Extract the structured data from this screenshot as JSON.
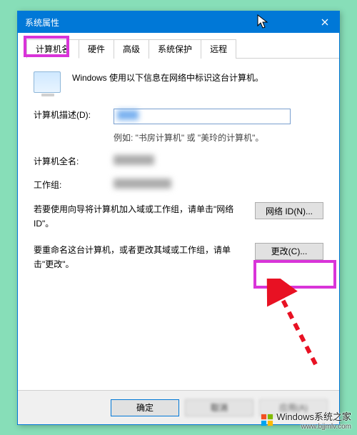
{
  "window": {
    "title": "系统属性"
  },
  "tabs": {
    "computer_name": "计算机名",
    "hardware": "硬件",
    "advanced": "高级",
    "system_protection": "系统保护",
    "remote": "远程"
  },
  "intro_text": "Windows 使用以下信息在网络中标识这台计算机。",
  "labels": {
    "description": "计算机描述(D):",
    "full_name": "计算机全名:",
    "workgroup": "工作组:"
  },
  "example_text": "例如: \"书房计算机\" 或 \"美玲的计算机\"。",
  "values": {
    "full_name": "DESKTOP",
    "workgroup": "WORKGROUP"
  },
  "network_id": {
    "text": "若要使用向导将计算机加入域或工作组，请单击\"网络 ID\"。",
    "button": "网络 ID(N)..."
  },
  "change": {
    "text": "要重命名这台计算机，或者更改其域或工作组，请单击\"更改\"。",
    "button": "更改(C)..."
  },
  "buttons": {
    "ok": "确定",
    "cancel": "取消",
    "apply": "应用(A)"
  },
  "watermark": {
    "brand": "Windows系统之家",
    "url": "www.bjjmlv.com"
  }
}
